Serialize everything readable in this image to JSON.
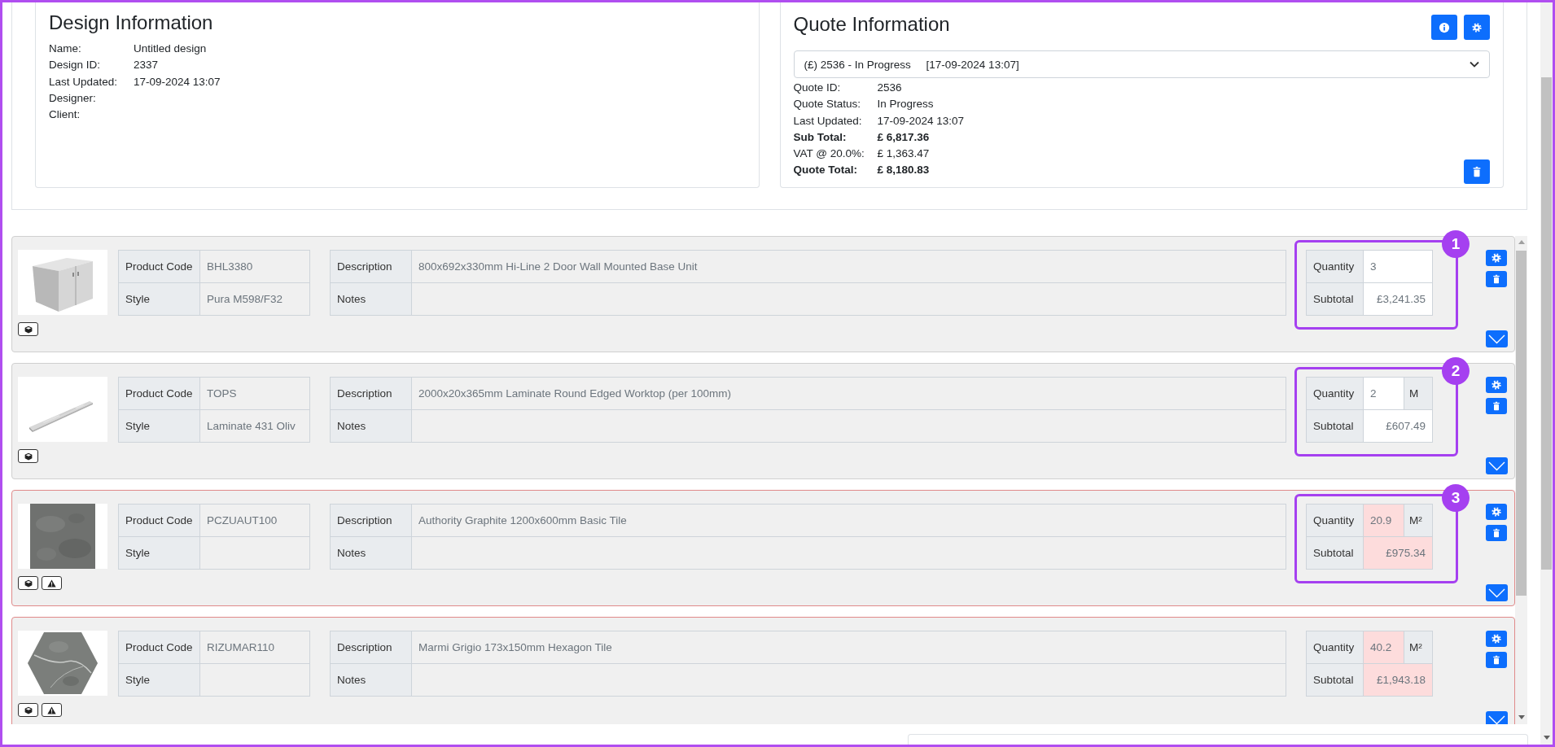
{
  "design_info": {
    "title": "Design Information",
    "fields": [
      {
        "label": "Name:",
        "value": "Untitled design"
      },
      {
        "label": "Design ID:",
        "value": "2337"
      },
      {
        "label": "Last Updated:",
        "value": "17-09-2024 13:07"
      },
      {
        "label": "Designer:"
      },
      {
        "label": "Client:"
      }
    ]
  },
  "quote_info": {
    "title": "Quote Information",
    "selector": "(£) 2536 - In Progress     [17-09-2024 13:07]",
    "fields": [
      {
        "label": "Quote ID:",
        "value": "2536",
        "bold": false
      },
      {
        "label": "Quote Status:",
        "value": "In Progress",
        "bold": false
      },
      {
        "label": "Last Updated:",
        "value": "17-09-2024 13:07",
        "bold": false
      },
      {
        "label": "Sub Total:",
        "value": "£ 6,817.36",
        "bold": true
      },
      {
        "label": "VAT @ 20.0%:",
        "value": "£ 1,363.47",
        "bold": false
      },
      {
        "label": "Quote Total:",
        "value": "£ 8,180.83",
        "bold": true
      }
    ]
  },
  "products": [
    {
      "code_label": "Product Code",
      "code": "BHL3380",
      "style_label": "Style",
      "style": "Pura M598/F32",
      "description_label": "Description",
      "description": "800x692x330mm Hi-Line 2 Door Wall Mounted Base Unit",
      "notes_label": "Notes",
      "quantity_label": "Quantity",
      "quantity": "3",
      "subtotal_label": "Subtotal",
      "subtotal": "£3,241.35",
      "warning": false,
      "callout": "1"
    },
    {
      "code_label": "Product Code",
      "code": "TOPS",
      "style_label": "Style",
      "style": "Laminate 431 Oliv",
      "description_label": "Description",
      "description": "2000x20x365mm Laminate Round Edged Worktop (per 100mm)",
      "notes_label": "Notes",
      "quantity_label": "Quantity",
      "quantity": "2",
      "unit": "M",
      "subtotal_label": "Subtotal",
      "subtotal": "£607.49",
      "warning": false,
      "callout": "2"
    },
    {
      "code_label": "Product Code",
      "code": "PCZUAUT100",
      "style_label": "Style",
      "description_label": "Description",
      "description": "Authority Graphite 1200x600mm Basic Tile",
      "notes_label": "Notes",
      "quantity_label": "Quantity",
      "quantity": "20.9",
      "unit": "M²",
      "subtotal_label": "Subtotal",
      "subtotal": "£975.34",
      "warning": true,
      "callout": "3"
    },
    {
      "code_label": "Product Code",
      "code": "RIZUMAR110",
      "style_label": "Style",
      "description_label": "Description",
      "description": "Marmi  Grigio 173x150mm Hexagon Tile",
      "notes_label": "Notes",
      "quantity_label": "Quantity",
      "quantity": "40.2",
      "unit": "M²",
      "subtotal_label": "Subtotal",
      "subtotal": "£1,943.18",
      "warning": true
    }
  ]
}
